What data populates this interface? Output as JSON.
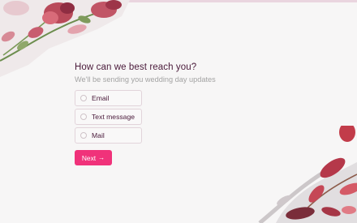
{
  "form": {
    "question": "How can we best reach you?",
    "subtitle": "We'll be sending you wedding day updates",
    "options": [
      {
        "label": "Email"
      },
      {
        "label": "Text message"
      },
      {
        "label": "Mail"
      }
    ],
    "next_label": "Next",
    "next_icon": "→"
  },
  "colors": {
    "accent": "#f0327a",
    "heading": "#4a1a3a",
    "subtitle": "#a3a3a3",
    "background": "#f7f6f6"
  }
}
